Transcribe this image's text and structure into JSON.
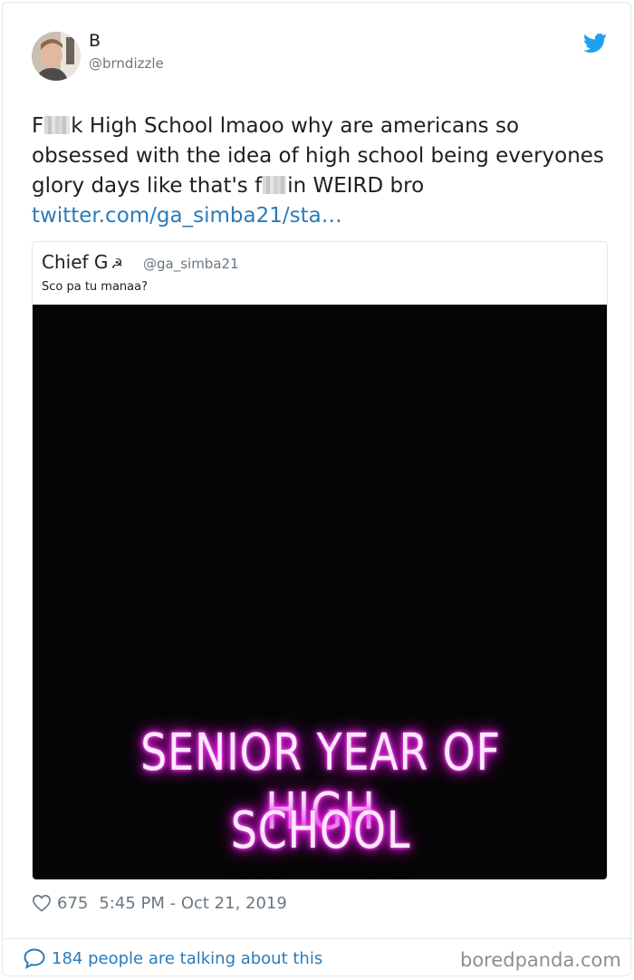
{
  "author": {
    "name": "B",
    "handle": "@brndizzle"
  },
  "tweet": {
    "text_part1": "F",
    "text_part2": "k High School lmaoo why are americans so obsessed with the idea of high school being everyones glory days like that's f",
    "text_part3": "in WEIRD bro",
    "link": "twitter.com/ga_simba21/sta…"
  },
  "quoted": {
    "name": "Chief G",
    "emoji": "☭",
    "handle": "@ga_simba21",
    "text": "Sco pa tu manaa?",
    "media_line1": "SENIOR YEAR OF HIGH",
    "media_line2": "SCHOOL"
  },
  "stats": {
    "likes": "675",
    "timestamp": "5:45 PM - Oct 21, 2019"
  },
  "footer": {
    "talking": "184 people are talking about this",
    "watermark": "boredpanda.com"
  },
  "icons": [
    "twitter-bird-icon",
    "heart-icon",
    "speech-bubble-icon"
  ],
  "colors": {
    "link": "#2b7bb9",
    "twitter_blue": "#1da1f2",
    "muted": "#697882",
    "neon": "#ff2bf5"
  }
}
